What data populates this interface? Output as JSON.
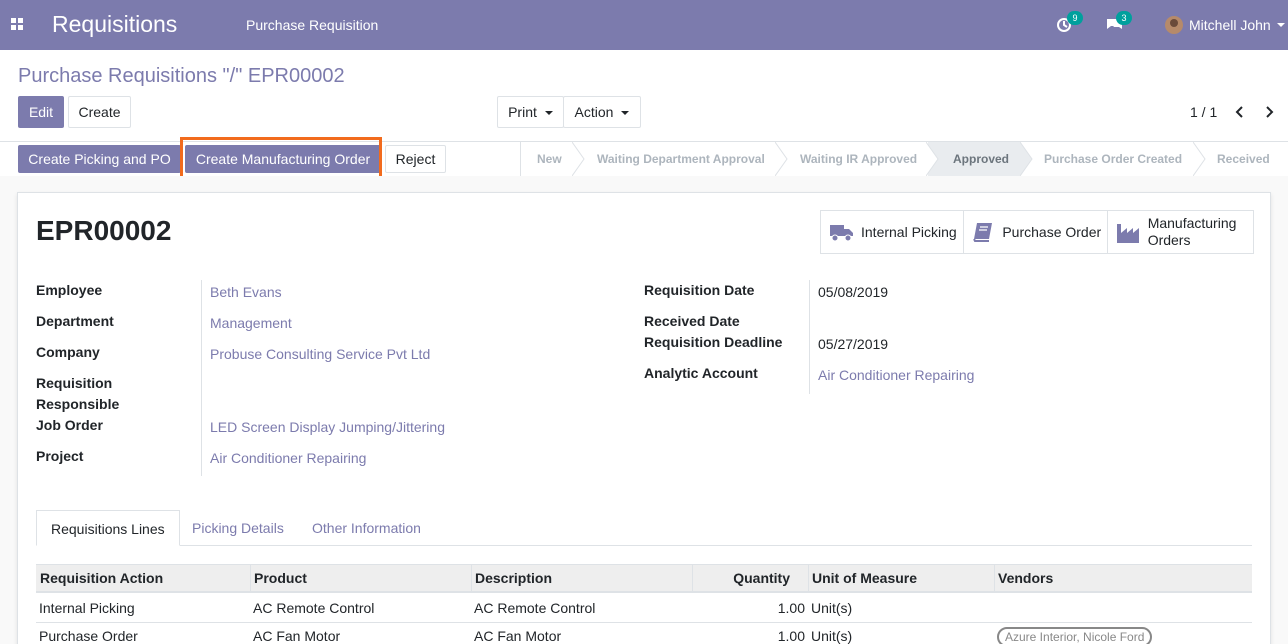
{
  "topbar": {
    "app_title": "Requisitions",
    "menu": "Purchase Requisition",
    "activity_count": "9",
    "messages_count": "3",
    "user_name": "Mitchell John"
  },
  "control": {
    "breadcrumb": "Purchase Requisitions \"/\" EPR00002",
    "edit_label": "Edit",
    "create_label": "Create",
    "print_label": "Print",
    "action_label": "Action",
    "pager": "1 / 1"
  },
  "statusbar": {
    "buttons": [
      "Create Picking and PO",
      "Create Manufacturing Order",
      "Reject"
    ],
    "stages": [
      "New",
      "Waiting Department Approval",
      "Waiting IR Approved",
      "Approved",
      "Purchase Order Created",
      "Received"
    ],
    "active_stage": "Approved"
  },
  "record": {
    "name": "EPR00002",
    "smart_buttons": {
      "internal_picking": "Internal Picking",
      "purchase_order": "Purchase Order",
      "manufacturing_line1": "Manufacturing",
      "manufacturing_line2": "Orders"
    },
    "left_fields": {
      "employee_label": "Employee",
      "employee_value": "Beth Evans",
      "department_label": "Department",
      "department_value": "Management",
      "company_label": "Company",
      "company_value": "Probuse Consulting Service Pvt Ltd",
      "responsible_label_1": "Requisition",
      "responsible_label_2": "Responsible",
      "job_order_label": "Job Order",
      "job_order_value": "LED Screen Display Jumping/Jittering",
      "project_label": "Project",
      "project_value": "Air Conditioner Repairing"
    },
    "right_fields": {
      "req_date_label": "Requisition Date",
      "req_date_value": "05/08/2019",
      "received_date_label": "Received Date",
      "deadline_label": "Requisition Deadline",
      "deadline_value": "05/27/2019",
      "analytic_label": "Analytic Account",
      "analytic_value": "Air Conditioner Repairing"
    }
  },
  "tabs": [
    "Requisitions Lines",
    "Picking Details",
    "Other Information"
  ],
  "table": {
    "headers": [
      "Requisition Action",
      "Product",
      "Description",
      "Quantity",
      "Unit of Measure",
      "Vendors"
    ],
    "rows": [
      {
        "action": "Internal Picking",
        "product": "AC Remote Control",
        "description": "AC Remote Control",
        "quantity": "1.00",
        "uom": "Unit(s)",
        "vendors": ""
      },
      {
        "action": "Purchase Order",
        "product": "AC Fan Motor",
        "description": "AC Fan Motor",
        "quantity": "1.00",
        "uom": "Unit(s)",
        "vendors": "Azure Interior, Nicole Ford"
      }
    ]
  }
}
